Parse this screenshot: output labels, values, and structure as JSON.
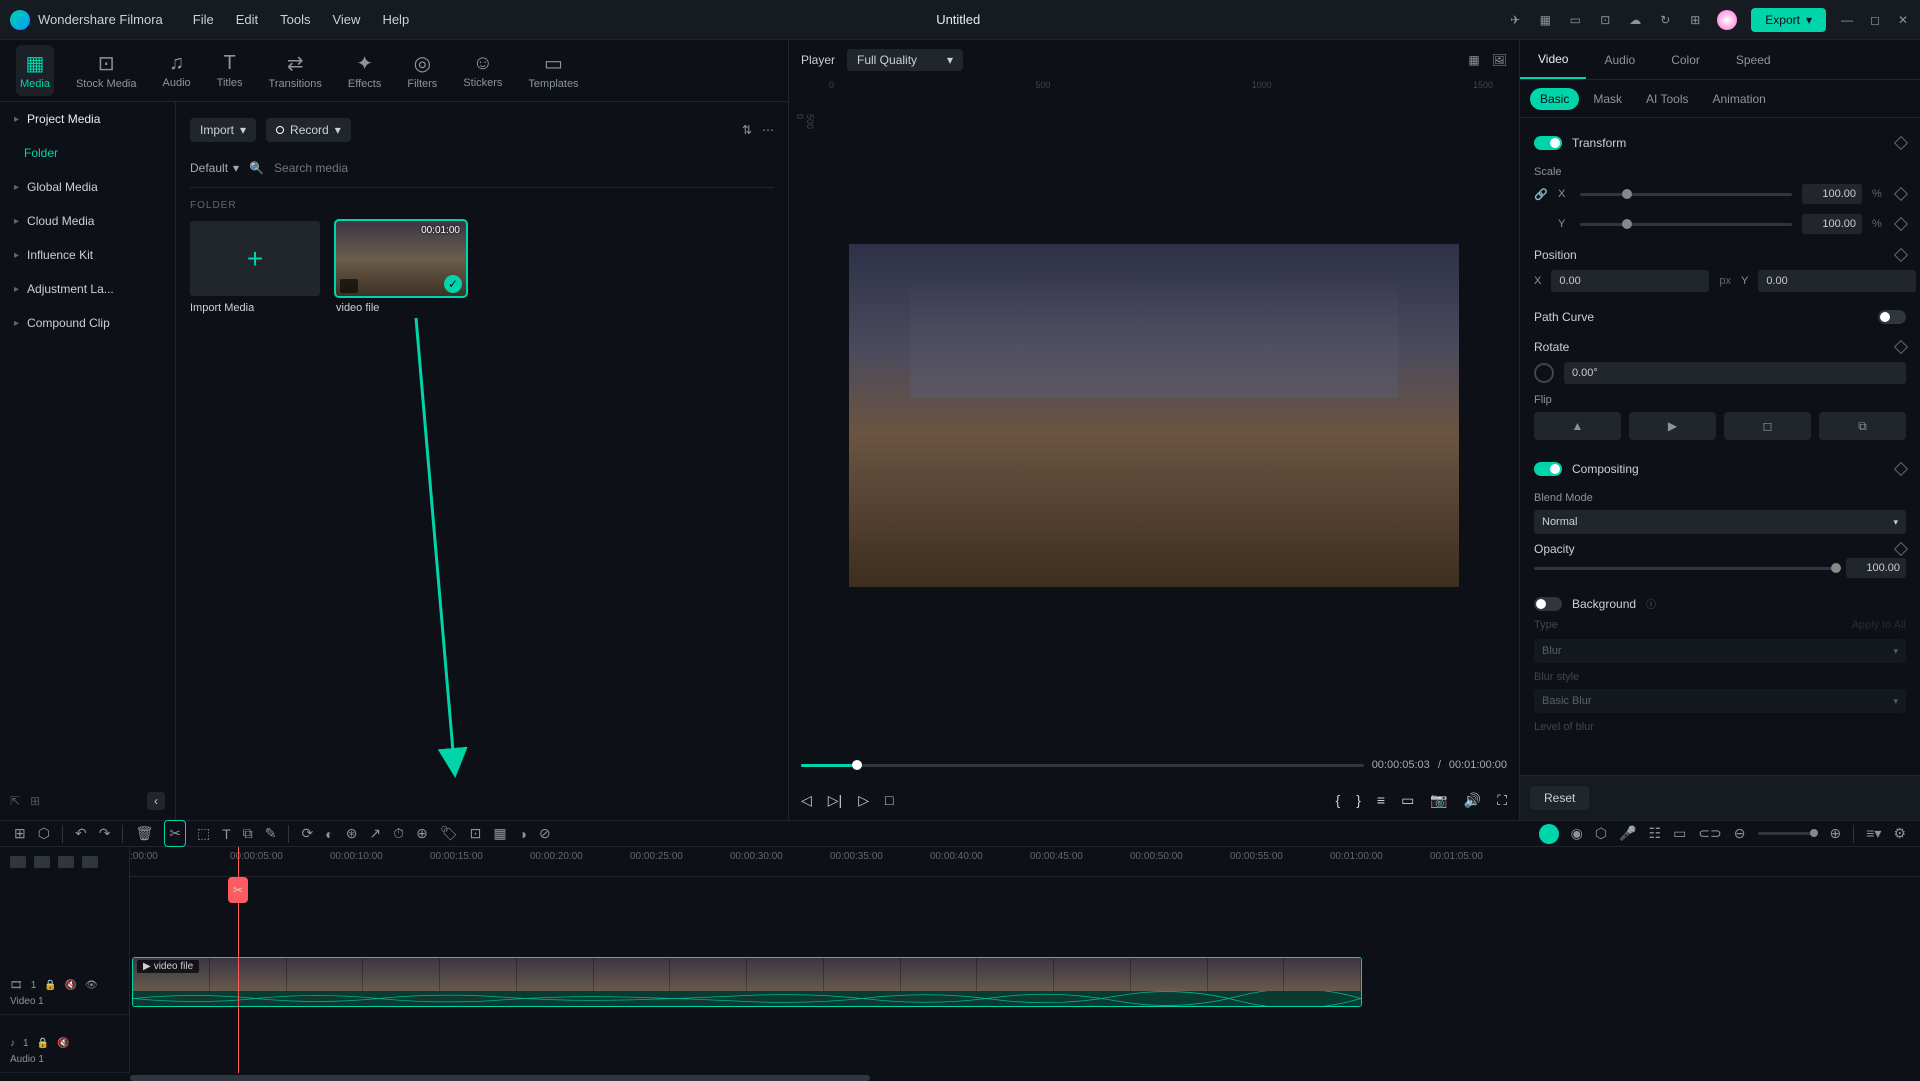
{
  "app": {
    "name": "Wondershare Filmora",
    "title": "Untitled"
  },
  "menu": [
    "File",
    "Edit",
    "Tools",
    "View",
    "Help"
  ],
  "export": "Export",
  "topTabs": [
    {
      "label": "Media",
      "icon": "▦"
    },
    {
      "label": "Stock Media",
      "icon": "⊡"
    },
    {
      "label": "Audio",
      "icon": "♫"
    },
    {
      "label": "Titles",
      "icon": "T"
    },
    {
      "label": "Transitions",
      "icon": "⇄"
    },
    {
      "label": "Effects",
      "icon": "✦"
    },
    {
      "label": "Filters",
      "icon": "◎"
    },
    {
      "label": "Stickers",
      "icon": "☺"
    },
    {
      "label": "Templates",
      "icon": "▭"
    }
  ],
  "sidebar": {
    "items": [
      "Project Media",
      "Global Media",
      "Cloud Media",
      "Influence Kit",
      "Adjustment La...",
      "Compound Clip"
    ],
    "folder": "Folder"
  },
  "mediaToolbar": {
    "import": "Import",
    "record": "Record",
    "default": "Default",
    "searchPlaceholder": "Search media",
    "folderLabel": "FOLDER"
  },
  "thumbs": {
    "importLabel": "Import Media",
    "clip": {
      "label": "video file",
      "duration": "00:01:00"
    }
  },
  "player": {
    "label": "Player",
    "quality": "Full Quality",
    "rulerH": [
      "0",
      "500",
      "1000",
      "1500"
    ],
    "rulerV": [
      "0",
      "500"
    ],
    "current": "00:00:05:03",
    "total": "00:01:00:00",
    "sep": "/"
  },
  "props": {
    "tabs": [
      "Video",
      "Audio",
      "Color",
      "Speed"
    ],
    "subtabs": [
      "Basic",
      "Mask",
      "AI Tools",
      "Animation"
    ],
    "transform": "Transform",
    "scale": "Scale",
    "scaleX": "100.00",
    "scaleY": "100.00",
    "pct": "%",
    "position": "Position",
    "posX": "0.00",
    "posY": "0.00",
    "px": "px",
    "pathCurve": "Path Curve",
    "rotate": "Rotate",
    "rotateVal": "0.00°",
    "flip": "Flip",
    "compositing": "Compositing",
    "blendMode": "Blend Mode",
    "blendVal": "Normal",
    "opacity": "Opacity",
    "opacityVal": "100.00",
    "background": "Background",
    "type": "Type",
    "typeVal": "Blur",
    "blurStyle": "Blur style",
    "blurStyleVal": "Basic Blur",
    "levelBlur": "Level of blur",
    "reset": "Reset",
    "applyAll": "Apply to All",
    "x": "X",
    "y": "Y"
  },
  "timeline": {
    "ticks": [
      ":00:00",
      "00:00:05:00",
      "00:00:10:00",
      "00:00:15:00",
      "00:00:20:00",
      "00:00:25:00",
      "00:00:30:00",
      "00:00:35:00",
      "00:00:40:00",
      "00:00:45:00",
      "00:00:50:00",
      "00:00:55:00",
      "00:01:00:00",
      "00:01:05:00"
    ],
    "video1": "Video 1",
    "audio1": "Audio 1",
    "clipLabel": "video file"
  }
}
